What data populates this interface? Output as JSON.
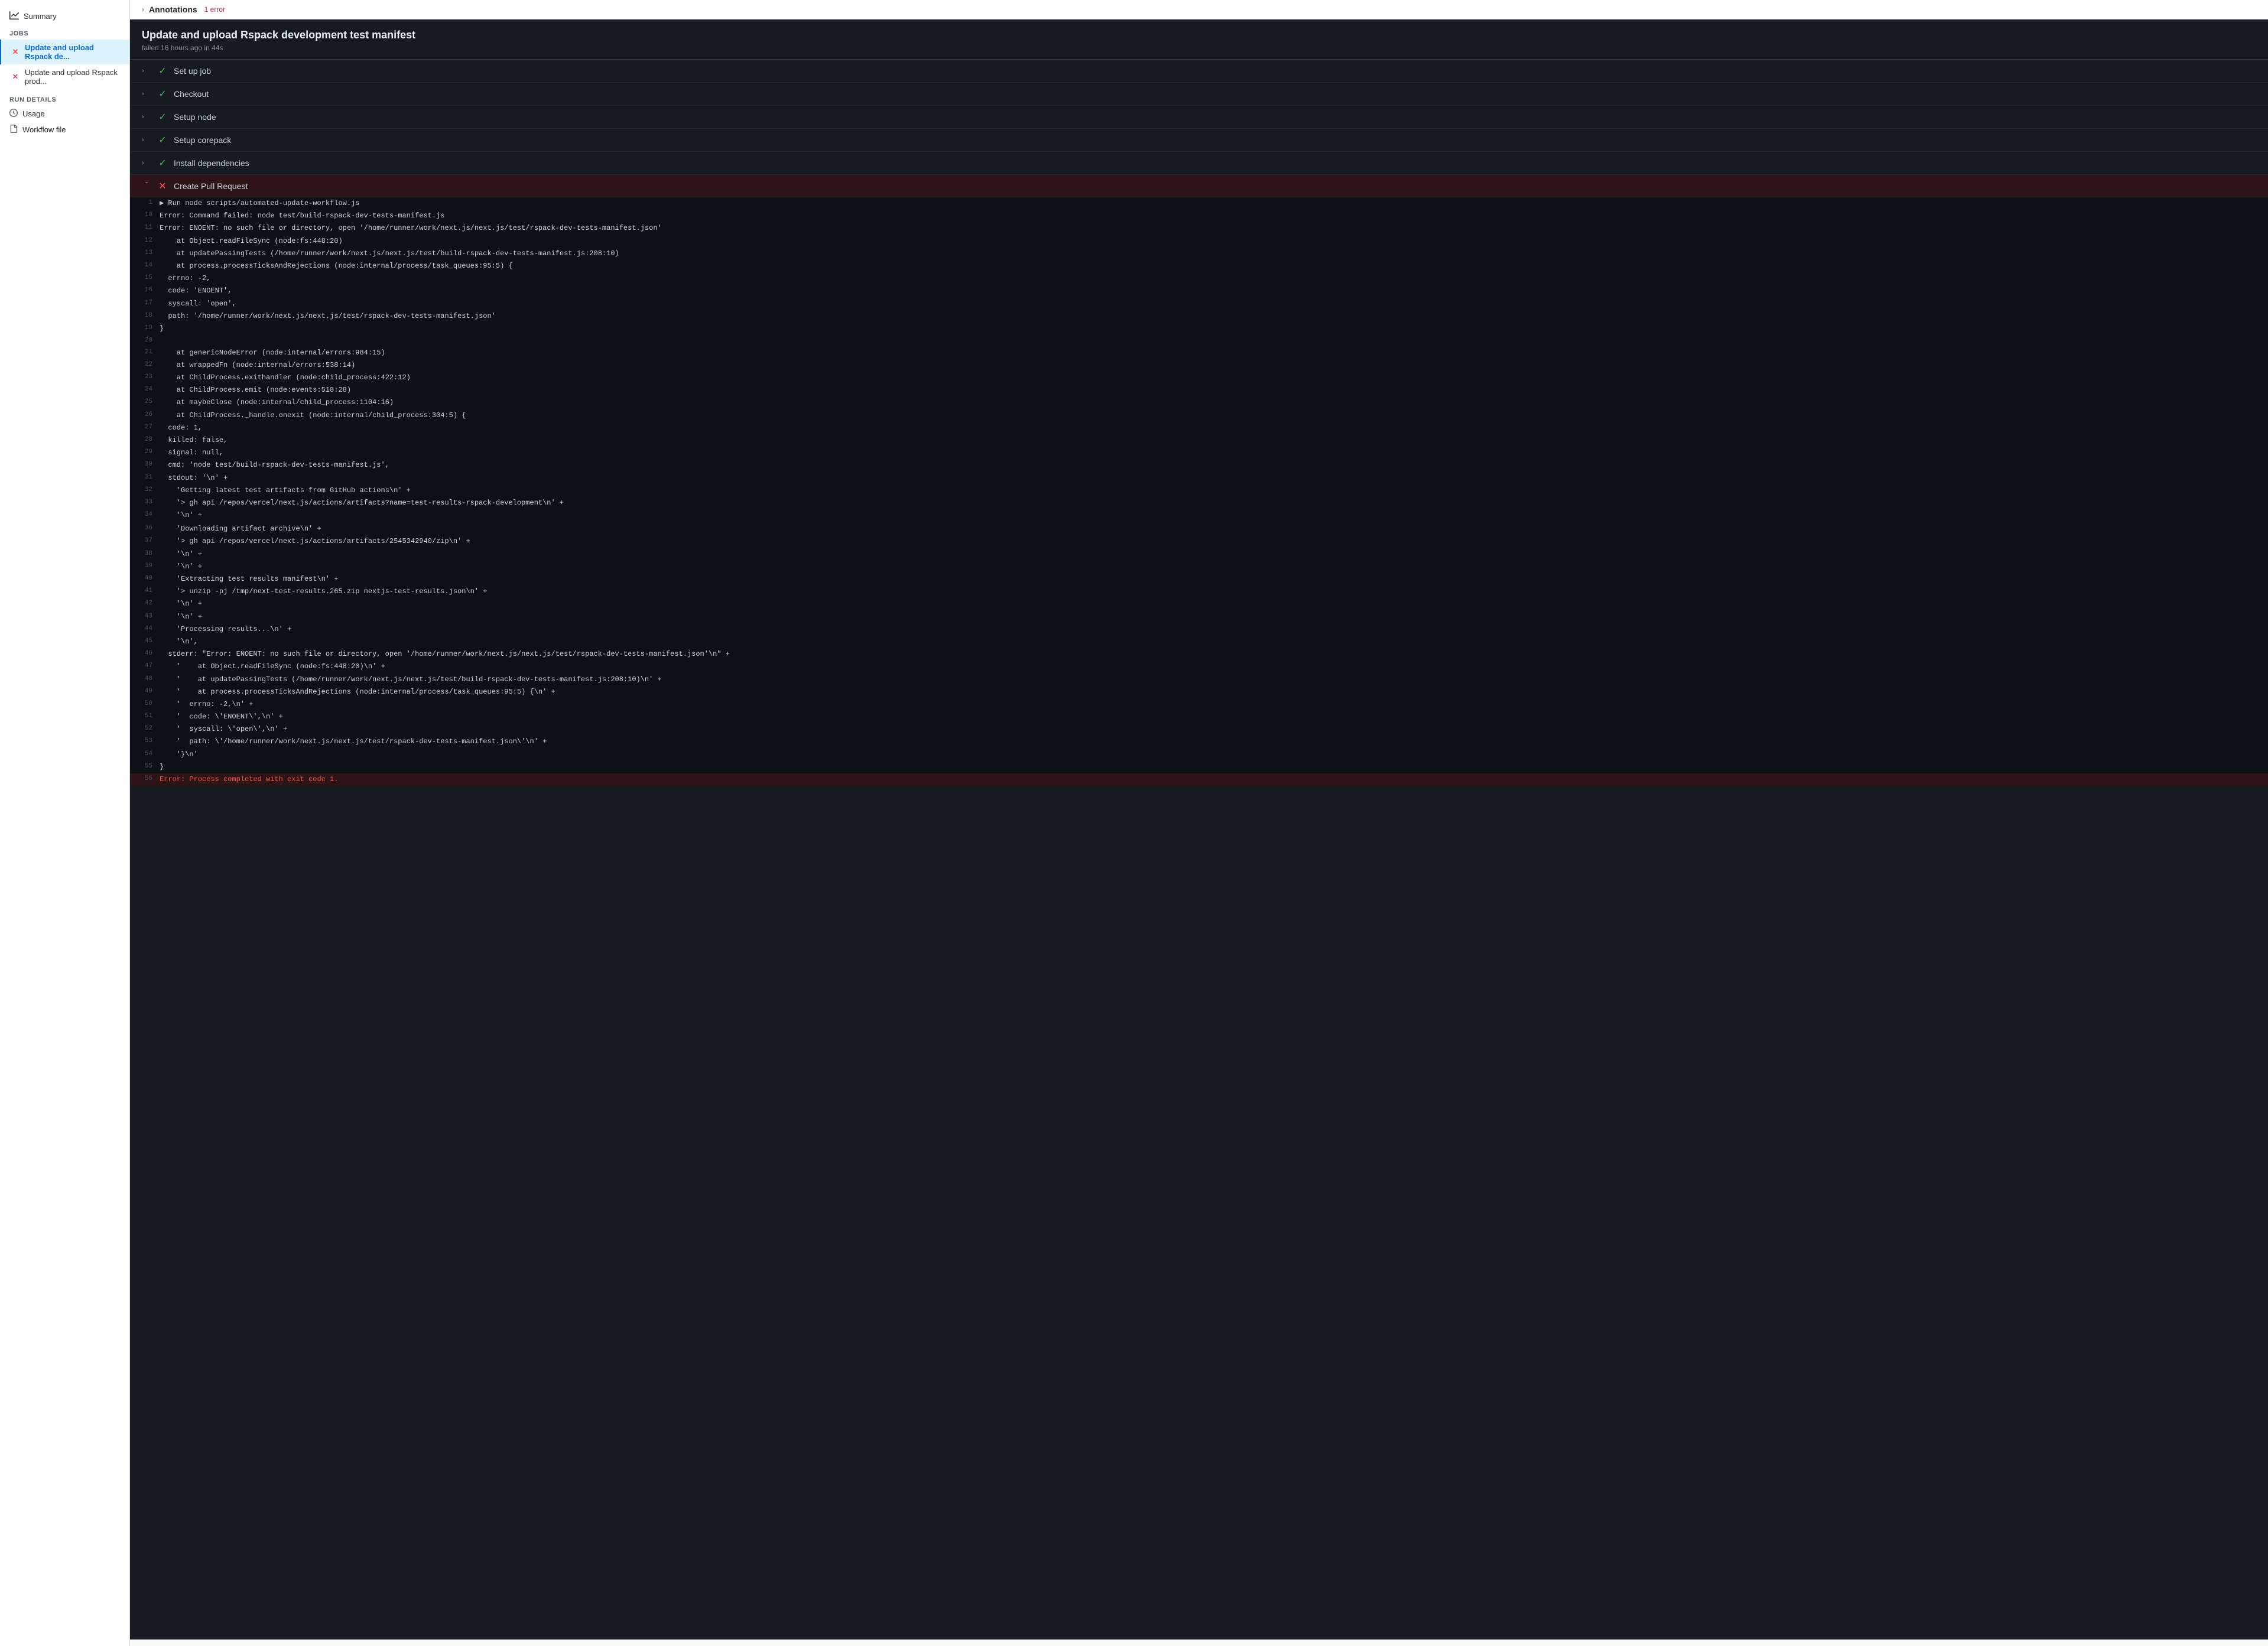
{
  "sidebar": {
    "summary_label": "Summary",
    "jobs_header": "Jobs",
    "jobs": [
      {
        "id": "job1",
        "label": "Update and upload Rspack de...",
        "status": "error",
        "active": true
      },
      {
        "id": "job2",
        "label": "Update and upload Rspack prod...",
        "status": "error",
        "active": false
      }
    ],
    "run_details_header": "Run details",
    "run_details": [
      {
        "id": "usage",
        "label": "Usage",
        "icon": "clock"
      },
      {
        "id": "workflow",
        "label": "Workflow file",
        "icon": "file"
      }
    ]
  },
  "annotations": {
    "title": "Annotations",
    "subtitle": "1 error"
  },
  "job": {
    "title": "Update and upload Rspack development test manifest",
    "meta": "failed 16 hours ago in 44s"
  },
  "steps": [
    {
      "id": "setup-job",
      "label": "Set up job",
      "status": "success",
      "expanded": false
    },
    {
      "id": "checkout",
      "label": "Checkout",
      "status": "success",
      "expanded": false
    },
    {
      "id": "setup-node",
      "label": "Setup node",
      "status": "success",
      "expanded": false
    },
    {
      "id": "setup-corepack",
      "label": "Setup corepack",
      "status": "success",
      "expanded": false
    },
    {
      "id": "install-deps",
      "label": "Install dependencies",
      "status": "success",
      "expanded": false
    },
    {
      "id": "create-pr",
      "label": "Create Pull Request",
      "status": "error",
      "expanded": true
    }
  ],
  "log_lines": [
    {
      "num": "1",
      "content": "▶ Run node scripts/automated-update-workflow.js",
      "type": "normal"
    },
    {
      "num": "10",
      "content": "Error: Command failed: node test/build-rspack-dev-tests-manifest.js",
      "type": "normal"
    },
    {
      "num": "11",
      "content": "Error: ENOENT: no such file or directory, open '/home/runner/work/next.js/next.js/test/rspack-dev-tests-manifest.json'",
      "type": "normal"
    },
    {
      "num": "12",
      "content": "    at Object.readFileSync (node:fs:448:20)",
      "type": "normal"
    },
    {
      "num": "13",
      "content": "    at updatePassingTests (/home/runner/work/next.js/next.js/test/build-rspack-dev-tests-manifest.js:208:10)",
      "type": "normal"
    },
    {
      "num": "14",
      "content": "    at process.processTicksAndRejections (node:internal/process/task_queues:95:5) {",
      "type": "normal"
    },
    {
      "num": "15",
      "content": "  errno: -2,",
      "type": "normal"
    },
    {
      "num": "16",
      "content": "  code: 'ENOENT',",
      "type": "normal"
    },
    {
      "num": "17",
      "content": "  syscall: 'open',",
      "type": "normal"
    },
    {
      "num": "18",
      "content": "  path: '/home/runner/work/next.js/next.js/test/rspack-dev-tests-manifest.json'",
      "type": "normal"
    },
    {
      "num": "19",
      "content": "}",
      "type": "normal"
    },
    {
      "num": "20",
      "content": "",
      "type": "normal"
    },
    {
      "num": "21",
      "content": "    at genericNodeError (node:internal/errors:984:15)",
      "type": "normal"
    },
    {
      "num": "22",
      "content": "    at wrappedFn (node:internal/errors:538:14)",
      "type": "normal"
    },
    {
      "num": "23",
      "content": "    at ChildProcess.exithandler (node:child_process:422:12)",
      "type": "normal"
    },
    {
      "num": "24",
      "content": "    at ChildProcess.emit (node:events:518:28)",
      "type": "normal"
    },
    {
      "num": "25",
      "content": "    at maybeClose (node:internal/child_process:1104:16)",
      "type": "normal"
    },
    {
      "num": "26",
      "content": "    at ChildProcess._handle.onexit (node:internal/child_process:304:5) {",
      "type": "normal"
    },
    {
      "num": "27",
      "content": "  code: 1,",
      "type": "normal"
    },
    {
      "num": "28",
      "content": "  killed: false,",
      "type": "normal"
    },
    {
      "num": "29",
      "content": "  signal: null,",
      "type": "normal"
    },
    {
      "num": "30",
      "content": "  cmd: 'node test/build-rspack-dev-tests-manifest.js',",
      "type": "normal"
    },
    {
      "num": "31",
      "content": "  stdout: '\\n' +",
      "type": "normal"
    },
    {
      "num": "32",
      "content": "    'Getting latest test artifacts from GitHub actions\\n' +",
      "type": "normal"
    },
    {
      "num": "33",
      "content": "    '> gh api /repos/vercel/next.js/actions/artifacts?name=test-results-rspack-development\\n' +",
      "type": "normal"
    },
    {
      "num": "34",
      "content": "    '\\n' +",
      "type": "normal"
    },
    {
      "num": "",
      "content": "",
      "type": "normal"
    },
    {
      "num": "36",
      "content": "    'Downloading artifact archive\\n' +",
      "type": "normal"
    },
    {
      "num": "37",
      "content": "    '> gh api /repos/vercel/next.js/actions/artifacts/2545342940/zip\\n' +",
      "type": "normal"
    },
    {
      "num": "38",
      "content": "    '\\n' +",
      "type": "normal"
    },
    {
      "num": "39",
      "content": "    '\\n' +",
      "type": "normal"
    },
    {
      "num": "40",
      "content": "    'Extracting test results manifest\\n' +",
      "type": "normal"
    },
    {
      "num": "41",
      "content": "    '> unzip -pj /tmp/next-test-results.265.zip nextjs-test-results.json\\n' +",
      "type": "normal"
    },
    {
      "num": "42",
      "content": "    '\\n' +",
      "type": "normal"
    },
    {
      "num": "43",
      "content": "    '\\n' +",
      "type": "normal"
    },
    {
      "num": "44",
      "content": "    'Processing results...\\n' +",
      "type": "normal"
    },
    {
      "num": "45",
      "content": "    '\\n',",
      "type": "normal"
    },
    {
      "num": "46",
      "content": "  stderr: \"Error: ENOENT: no such file or directory, open '/home/runner/work/next.js/next.js/test/rspack-dev-tests-manifest.json'\\n\" +",
      "type": "normal"
    },
    {
      "num": "47",
      "content": "    '    at Object.readFileSync (node:fs:448:20)\\n' +",
      "type": "normal"
    },
    {
      "num": "48",
      "content": "    '    at updatePassingTests (/home/runner/work/next.js/next.js/test/build-rspack-dev-tests-manifest.js:208:10)\\n' +",
      "type": "normal"
    },
    {
      "num": "49",
      "content": "    '    at process.processTicksAndRejections (node:internal/process/task_queues:95:5) {\\n' +",
      "type": "normal"
    },
    {
      "num": "50",
      "content": "    '  errno: -2,\\n' +",
      "type": "normal"
    },
    {
      "num": "51",
      "content": "    '  code: \\'ENOENT\\',\\n' +",
      "type": "normal"
    },
    {
      "num": "52",
      "content": "    '  syscall: \\'open\\',\\n' +",
      "type": "normal"
    },
    {
      "num": "53",
      "content": "    '  path: \\'/home/runner/work/next.js/next.js/test/rspack-dev-tests-manifest.json\\'\\n' +",
      "type": "normal"
    },
    {
      "num": "54",
      "content": "    '}\\n'",
      "type": "normal"
    },
    {
      "num": "55",
      "content": "}",
      "type": "normal"
    },
    {
      "num": "56",
      "content": "Error: Process completed with exit code 1.",
      "type": "error"
    }
  ],
  "colors": {
    "success": "#3fb950",
    "error": "#f85149",
    "error_text": "#f85149",
    "sidebar_active_bg": "#ddf4ff",
    "sidebar_active_border": "#0969da"
  }
}
